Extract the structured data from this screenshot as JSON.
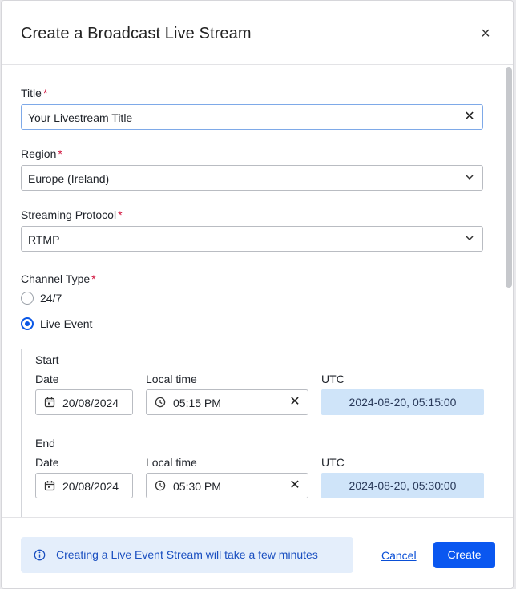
{
  "dialog": {
    "title": "Create a Broadcast Live Stream",
    "close_glyph": "×"
  },
  "form": {
    "title_field": {
      "label": "Title",
      "required_mark": "*",
      "value": "Your Livestream Title",
      "clear_glyph": "✕"
    },
    "region": {
      "label": "Region",
      "required_mark": "*",
      "value": "Europe (Ireland)"
    },
    "protocol": {
      "label": "Streaming Protocol",
      "required_mark": "*",
      "value": "RTMP"
    },
    "channel_type": {
      "label": "Channel Type",
      "required_mark": "*",
      "options": [
        {
          "label": "24/7",
          "selected": false
        },
        {
          "label": "Live Event",
          "selected": true
        }
      ]
    },
    "schedule": {
      "start": {
        "heading": "Start",
        "date_label": "Date",
        "date_value": "20/08/2024",
        "time_label": "Local time",
        "time_value": "05:15 PM",
        "utc_label": "UTC",
        "utc_value": "2024-08-20, 05:15:00"
      },
      "end": {
        "heading": "End",
        "date_label": "Date",
        "date_value": "20/08/2024",
        "time_label": "Local time",
        "time_value": "05:30 PM",
        "utc_label": "UTC",
        "utc_value": "2024-08-20, 05:30:00"
      },
      "clear_glyph": "✕"
    }
  },
  "footer": {
    "notice": "Creating a Live Event Stream will take a few minutes",
    "cancel_label": "Cancel",
    "create_label": "Create"
  },
  "colors": {
    "accent": "#0a57f0",
    "required": "#d0103a",
    "utc_bg": "#cfe4f9",
    "notice_bg": "#e4eefb"
  }
}
